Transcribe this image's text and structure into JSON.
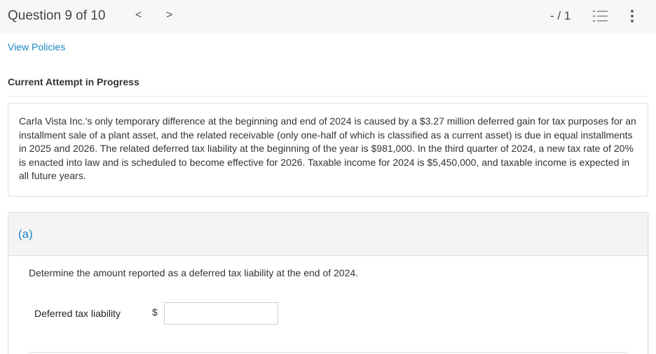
{
  "header": {
    "question_position": "Question 9 of 10",
    "prev_label": "<",
    "next_label": ">",
    "score": "- / 1",
    "icons": [
      "list-numbered-icon",
      "more-vertical-icon"
    ]
  },
  "links": {
    "view_policies": "View Policies"
  },
  "attempt": {
    "status": "Current Attempt in Progress"
  },
  "question": {
    "text": "Carla Vista Inc.'s only temporary difference at the beginning and end of 2024 is caused by a $3.27 million deferred gain for tax purposes for an installment sale of a plant asset, and the related receivable (only one-half of which is classified as a current asset) is due in equal installments in 2025 and 2026. The related deferred tax liability at the beginning of the year is $981,000. In the third quarter of 2024, a new tax rate of 20% is enacted into law and is scheduled to become effective for 2026. Taxable income for 2024 is $5,450,000, and taxable income is expected in all future years."
  },
  "part_a": {
    "label": "(a)",
    "prompt": "Determine the amount reported as a deferred tax liability at the end of 2024.",
    "field_label": "Deferred tax liability",
    "currency_symbol": "$",
    "value": ""
  },
  "colors": {
    "accent": "#1a86c5",
    "header_bg": "#f7f7f7",
    "panel_head_bg": "#f4f4f4"
  }
}
